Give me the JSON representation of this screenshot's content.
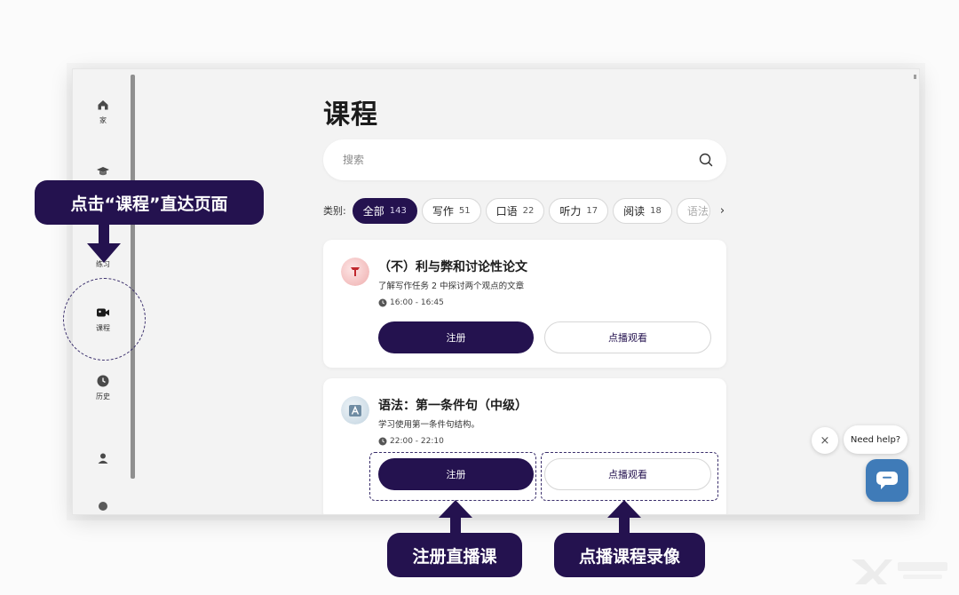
{
  "sidebar": {
    "items": [
      {
        "label": "家",
        "icon": "home-icon"
      },
      {
        "label": "",
        "icon": "graduation-cap-icon"
      },
      {
        "label": "练习",
        "icon": "practice-icon"
      },
      {
        "label": "课程",
        "icon": "video-camera-icon"
      },
      {
        "label": "历史",
        "icon": "clock-icon"
      },
      {
        "label": "",
        "icon": "user-icon"
      },
      {
        "label": "",
        "icon": "more-icon"
      }
    ]
  },
  "main": {
    "title": "课程",
    "search": {
      "placeholder": "搜索",
      "value": ""
    },
    "filter": {
      "label": "类别:",
      "chips": [
        {
          "name": "全部",
          "count": "143"
        },
        {
          "name": "写作",
          "count": "51"
        },
        {
          "name": "口语",
          "count": "22"
        },
        {
          "name": "听力",
          "count": "17"
        },
        {
          "name": "阅读",
          "count": "18"
        },
        {
          "name": "语法",
          "count": ""
        }
      ],
      "next_label": "›"
    },
    "cards": [
      {
        "title": "（不）利与弊和讨论性论文",
        "desc": "了解写作任务 2 中探讨两个观点的文章",
        "time": "16:00 - 16:45",
        "register_label": "注册",
        "vod_label": "点播观看",
        "icon": "writing-pen-icon"
      },
      {
        "title": "语法：第一条件句（中级）",
        "desc": "学习使用第一条件句结构。",
        "time": "22:00 - 22:10",
        "register_label": "注册",
        "vod_label": "点播观看",
        "icon": "grammar-letter-icon"
      }
    ]
  },
  "annotations": {
    "nav_callout": "点击“课程”直达页面",
    "register_callout": "注册直播课",
    "vod_callout": "点播课程录像"
  },
  "help": {
    "bubble_text": "Need help?",
    "close_label": "×"
  },
  "colors": {
    "primary": "#24124f",
    "chat": "#3f7bb8",
    "background": "#f3f3f3"
  }
}
